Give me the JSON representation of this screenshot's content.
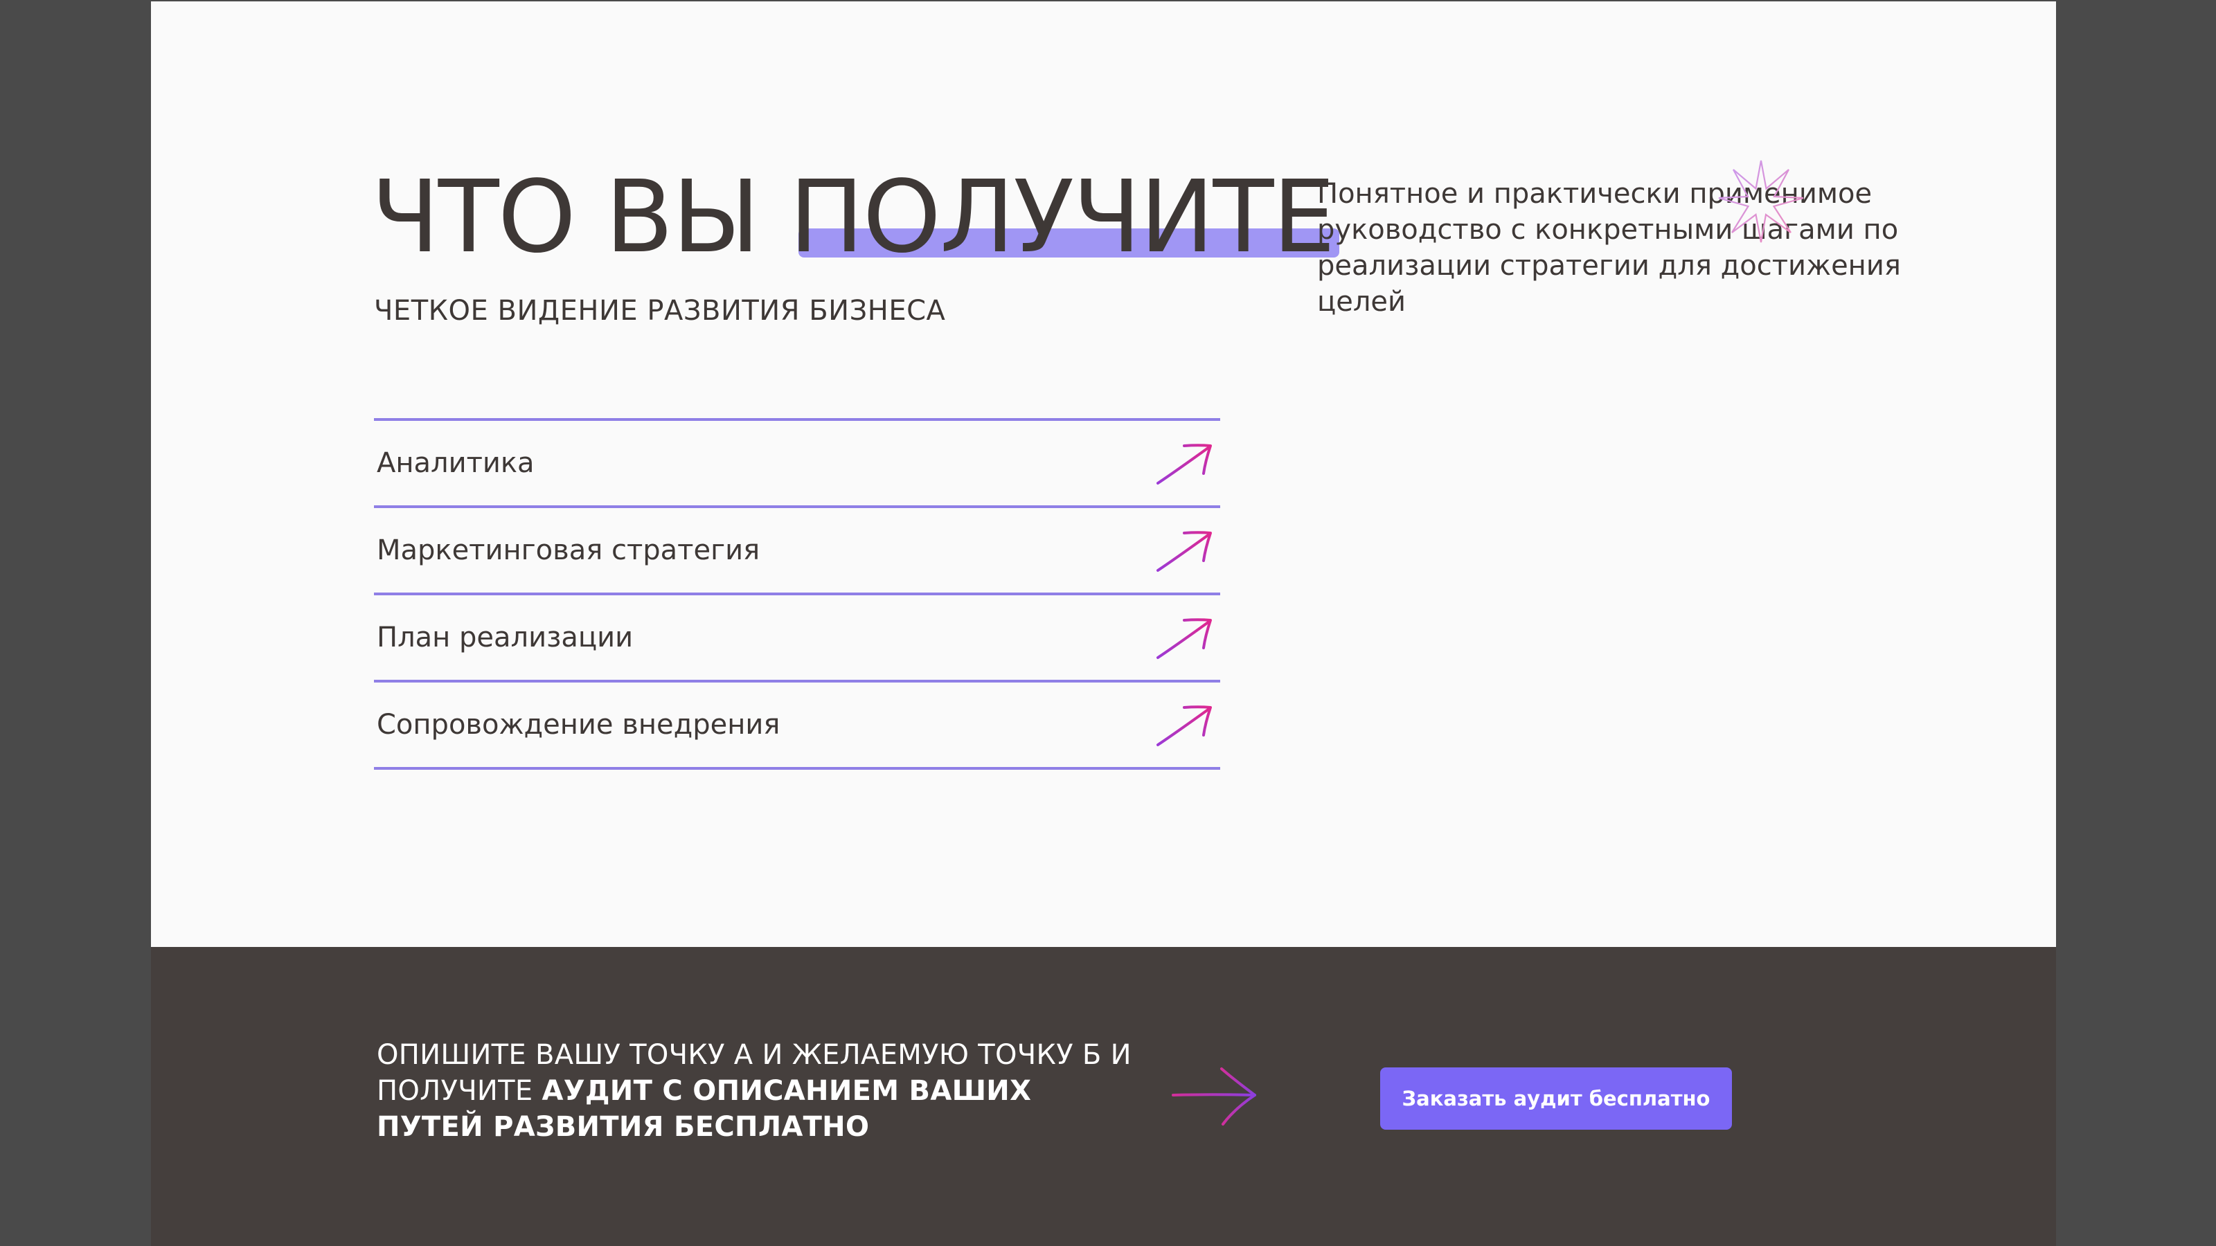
{
  "hero": {
    "headline_part1": "ЧТО ВЫ ",
    "headline_highlight": "ПОЛУЧИТЕ",
    "subheading": "ЧЕТКОЕ ВИДЕНИЕ РАЗВИТИЯ БИЗНЕСА",
    "description": "Понятное и практически применимое руководство с конкретными шагами по реализации стратегии для достижения целей",
    "highlight_color": "#a096f4"
  },
  "features": {
    "items": [
      {
        "label": "Аналитика",
        "icon": "arrow-up-right-icon"
      },
      {
        "label": "Маркетинговая стратегия",
        "icon": "arrow-up-right-icon"
      },
      {
        "label": "План реализации",
        "icon": "arrow-up-right-icon"
      },
      {
        "label": "Сопровождение внедрения",
        "icon": "arrow-up-right-icon"
      }
    ],
    "divider_color": "#8f7fe6"
  },
  "cta": {
    "text_regular": "ОПИШИТЕ ВАШУ ТОЧКУ А И ЖЕЛАЕМУЮ ТОЧКУ Б И ПОЛУЧИТЕ ",
    "text_bold": "АУДИТ С ОПИСАНИЕМ ВАШИХ ПУТЕЙ РАЗВИТИЯ БЕСПЛАТНО",
    "button_label": "Заказать аудит бесплатно",
    "button_color": "#7b67f5",
    "background_color": "#453f3d",
    "icon": "arrow-right-icon"
  },
  "decor": {
    "star_icon": "sparkle-star-icon"
  }
}
